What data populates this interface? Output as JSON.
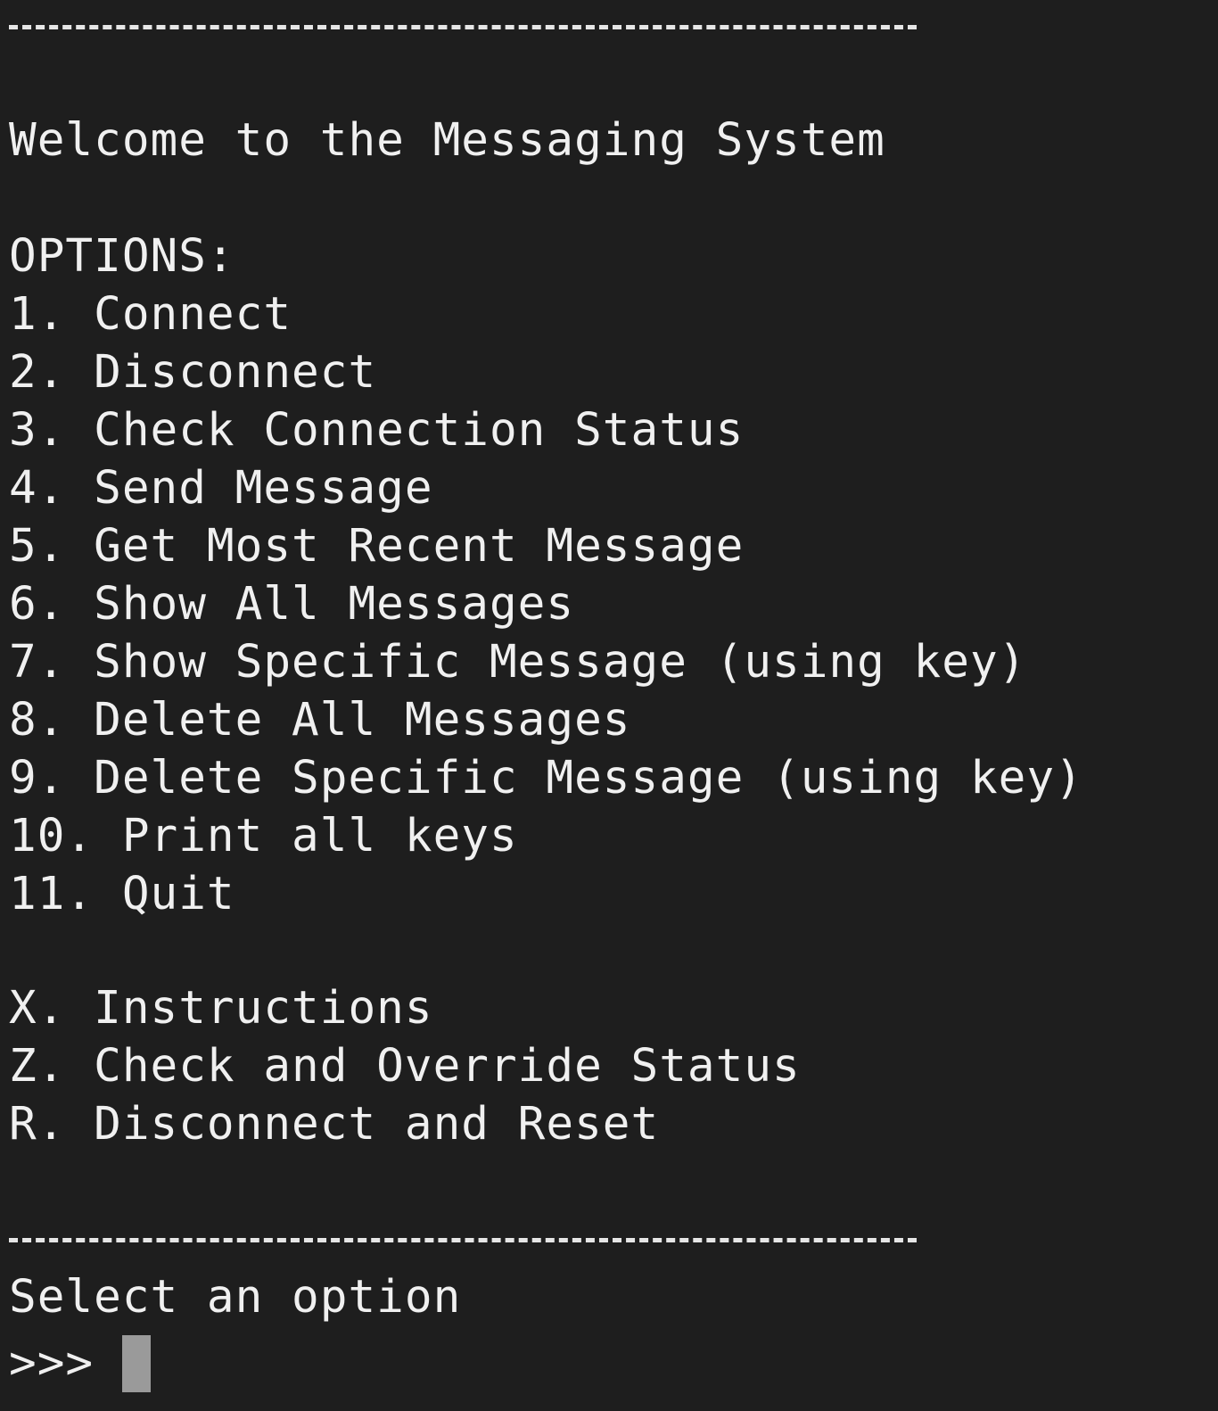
{
  "terminal": {
    "welcome": "Welcome to the Messaging System",
    "options_header": "OPTIONS:",
    "options": [
      "1. Connect",
      "2. Disconnect",
      "3. Check Connection Status",
      "4. Send Message",
      "5. Get Most Recent Message",
      "6. Show All Messages",
      "7. Show Specific Message (using key)",
      "8. Delete All Messages",
      "9. Delete Specific Message (using key)",
      "10. Print all keys",
      "11. Quit"
    ],
    "extra_options": [
      "X. Instructions",
      "Z. Check and Override Status",
      "R. Disconnect and Reset"
    ],
    "select_prompt": "Select an option",
    "input_prompt": ">>>"
  },
  "colors": {
    "background": "#1e1e1e",
    "text": "#f0f0f0",
    "cursor": "#9a9a9a"
  }
}
